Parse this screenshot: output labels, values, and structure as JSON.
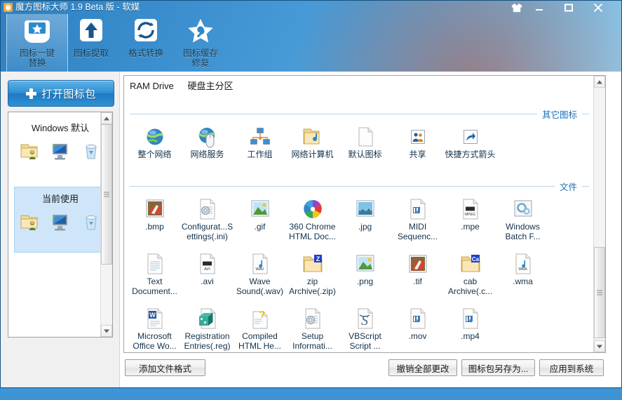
{
  "window": {
    "title": "魔方图标大师 1.9 Beta 版 - 软媒",
    "app_icon": "magic-cube-icon",
    "controls": [
      {
        "name": "skin-button",
        "icon": "tshirt-icon"
      },
      {
        "name": "minimize-button",
        "icon": "minimize-icon"
      },
      {
        "name": "maximize-button",
        "icon": "maximize-icon"
      },
      {
        "name": "close-button",
        "icon": "close-icon"
      }
    ]
  },
  "toolbar": {
    "items": [
      {
        "label_line1": "图标一键",
        "label_line2": "替换",
        "icon": "star-badge-icon",
        "active": true
      },
      {
        "label_line1": "图标提取",
        "label_line2": "",
        "icon": "up-arrow-icon",
        "active": false
      },
      {
        "label_line1": "格式转换",
        "label_line2": "",
        "icon": "refresh-icon",
        "active": false
      },
      {
        "label_line1": "图标缓存",
        "label_line2": "修复",
        "icon": "star-wrench-icon",
        "active": false
      }
    ]
  },
  "sidebar": {
    "open_pack_button": "打开图标包",
    "packs": [
      {
        "name": "Windows 默认",
        "selected": false,
        "icons": [
          "user-folder-icon",
          "computer-icon",
          "recycle-bin-icon"
        ]
      },
      {
        "name": "当前使用",
        "selected": true,
        "icons": [
          "user-folder-icon",
          "computer-icon",
          "recycle-bin-icon"
        ]
      }
    ]
  },
  "content": {
    "tabs": [
      {
        "label": "RAM Drive"
      },
      {
        "label": "硬盘主分区"
      }
    ],
    "sections": [
      {
        "title": "其它图标",
        "rows": [
          [
            {
              "caption": "整个网络",
              "icon": "globe-icon"
            },
            {
              "caption": "网络服务",
              "icon": "globe-mouse-icon"
            },
            {
              "caption": "工作组",
              "icon": "workgroup-icon"
            },
            {
              "caption": "网络计算机",
              "icon": "network-folder-icon"
            },
            {
              "caption": "默认图标",
              "icon": "blank-document-icon"
            },
            {
              "caption": "共享",
              "icon": "share-users-icon"
            },
            {
              "caption": "快捷方式箭头",
              "icon": "shortcut-arrow-icon"
            }
          ]
        ]
      },
      {
        "title": "文件",
        "rows": [
          [
            {
              "caption": ".bmp",
              "icon": "bmp-file-icon"
            },
            {
              "caption": "Configurat...Settings(.ini)",
              "icon": "ini-file-icon"
            },
            {
              "caption": ".gif",
              "icon": "gif-file-icon"
            },
            {
              "caption": "360 Chrome HTML Doc...",
              "icon": "chrome-pinwheel-icon"
            },
            {
              "caption": ".jpg",
              "icon": "jpg-file-icon"
            },
            {
              "caption": "MIDI Sequenc...",
              "icon": "midi-file-icon"
            },
            {
              "caption": ".mpe",
              "icon": "mpeg-file-icon"
            },
            {
              "caption": "Windows Batch F...",
              "icon": "batch-file-icon"
            }
          ],
          [
            {
              "caption": "Text Document...",
              "icon": "text-file-icon"
            },
            {
              "caption": ".avi",
              "icon": "avi-file-icon"
            },
            {
              "caption": "Wave Sound(.wav)",
              "icon": "wav-file-icon"
            },
            {
              "caption": "zip Archive(.zip)",
              "icon": "zip-folder-icon"
            },
            {
              "caption": ".png",
              "icon": "png-file-icon"
            },
            {
              "caption": ".tif",
              "icon": "tif-file-icon"
            },
            {
              "caption": "cab Archive(.c...",
              "icon": "cab-folder-icon"
            },
            {
              "caption": ".wma",
              "icon": "wma-file-icon"
            }
          ],
          [
            {
              "caption": "Microsoft Office Wo...",
              "icon": "word-doc-icon"
            },
            {
              "caption": "Registration Entries(.reg)",
              "icon": "reg-file-icon"
            },
            {
              "caption": "Compiled HTML He...",
              "icon": "chm-file-icon"
            },
            {
              "caption": "Setup Informati...",
              "icon": "inf-file-icon"
            },
            {
              "caption": "VBScript Script ...",
              "icon": "vbs-file-icon"
            },
            {
              "caption": ".mov",
              "icon": "mov-file-icon"
            },
            {
              "caption": ".mp4",
              "icon": "mp4-file-icon"
            }
          ]
        ]
      }
    ]
  },
  "footer": {
    "add_format": "添加文件格式",
    "undo_all": "撤销全部更改",
    "save_pack_as": "图标包另存为...",
    "apply_to_system": "应用到系统"
  },
  "colors": {
    "titlebar_blue": "#3c90cf",
    "accent_blue": "#1a6fb5",
    "selection_blue": "#cfe6fa",
    "button_face": "#efefef"
  }
}
